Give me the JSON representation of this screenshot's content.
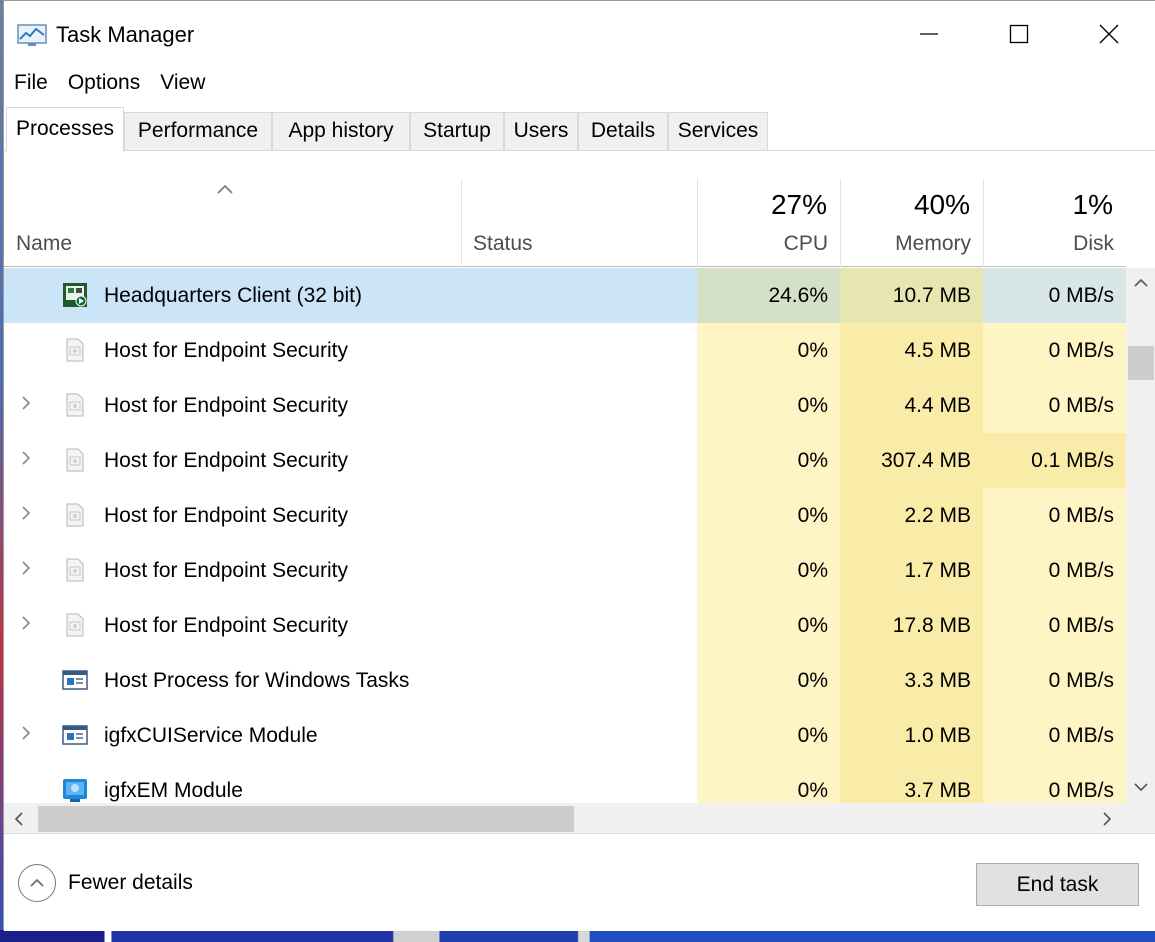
{
  "window": {
    "title": "Task Manager",
    "controls": {
      "minimize": "—",
      "maximize": "☐",
      "close": "✕"
    }
  },
  "menu": [
    "File",
    "Options",
    "View"
  ],
  "tabs": [
    {
      "label": "Processes",
      "active": true
    },
    {
      "label": "Performance",
      "active": false
    },
    {
      "label": "App history",
      "active": false
    },
    {
      "label": "Startup",
      "active": false
    },
    {
      "label": "Users",
      "active": false
    },
    {
      "label": "Details",
      "active": false
    },
    {
      "label": "Services",
      "active": false
    }
  ],
  "columns": {
    "name": "Name",
    "status": "Status",
    "cpu": {
      "percent": "27%",
      "label": "CPU"
    },
    "memory": {
      "percent": "40%",
      "label": "Memory"
    },
    "disk": {
      "percent": "1%",
      "label": "Disk"
    }
  },
  "processes": [
    {
      "name": "Headquarters Client (32 bit)",
      "icon": "headquarters-icon",
      "expandable": false,
      "selected": true,
      "cpu": "24.6%",
      "memory": "10.7 MB",
      "disk": "0 MB/s"
    },
    {
      "name": "Host for Endpoint Security",
      "icon": "generic-app-icon",
      "expandable": false,
      "selected": false,
      "cpu": "0%",
      "memory": "4.5 MB",
      "disk": "0 MB/s"
    },
    {
      "name": "Host for Endpoint Security",
      "icon": "generic-app-icon",
      "expandable": true,
      "selected": false,
      "cpu": "0%",
      "memory": "4.4 MB",
      "disk": "0 MB/s"
    },
    {
      "name": "Host for Endpoint Security",
      "icon": "generic-app-icon",
      "expandable": true,
      "selected": false,
      "cpu": "0%",
      "memory": "307.4 MB",
      "disk": "0.1 MB/s"
    },
    {
      "name": "Host for Endpoint Security",
      "icon": "generic-app-icon",
      "expandable": true,
      "selected": false,
      "cpu": "0%",
      "memory": "2.2 MB",
      "disk": "0 MB/s"
    },
    {
      "name": "Host for Endpoint Security",
      "icon": "generic-app-icon",
      "expandable": true,
      "selected": false,
      "cpu": "0%",
      "memory": "1.7 MB",
      "disk": "0 MB/s"
    },
    {
      "name": "Host for Endpoint Security",
      "icon": "generic-app-icon",
      "expandable": true,
      "selected": false,
      "cpu": "0%",
      "memory": "17.8 MB",
      "disk": "0 MB/s"
    },
    {
      "name": "Host Process for Windows Tasks",
      "icon": "window-process-icon",
      "expandable": false,
      "selected": false,
      "cpu": "0%",
      "memory": "3.3 MB",
      "disk": "0 MB/s"
    },
    {
      "name": "igfxCUIService Module",
      "icon": "window-process-icon",
      "expandable": true,
      "selected": false,
      "cpu": "0%",
      "memory": "1.0 MB",
      "disk": "0 MB/s"
    },
    {
      "name": "igfxEM Module",
      "icon": "intel-graphics-icon",
      "expandable": false,
      "selected": false,
      "cpu": "0%",
      "memory": "3.7 MB",
      "disk": "0 MB/s"
    }
  ],
  "footer": {
    "fewer_details": "Fewer details",
    "end_task": "End task"
  },
  "colors": {
    "selected_row": "#cce4f7",
    "cpu_heat": "#fff4c4",
    "memory_heat": "#f9eca8",
    "disk_heat_high": "#f9eca8"
  }
}
